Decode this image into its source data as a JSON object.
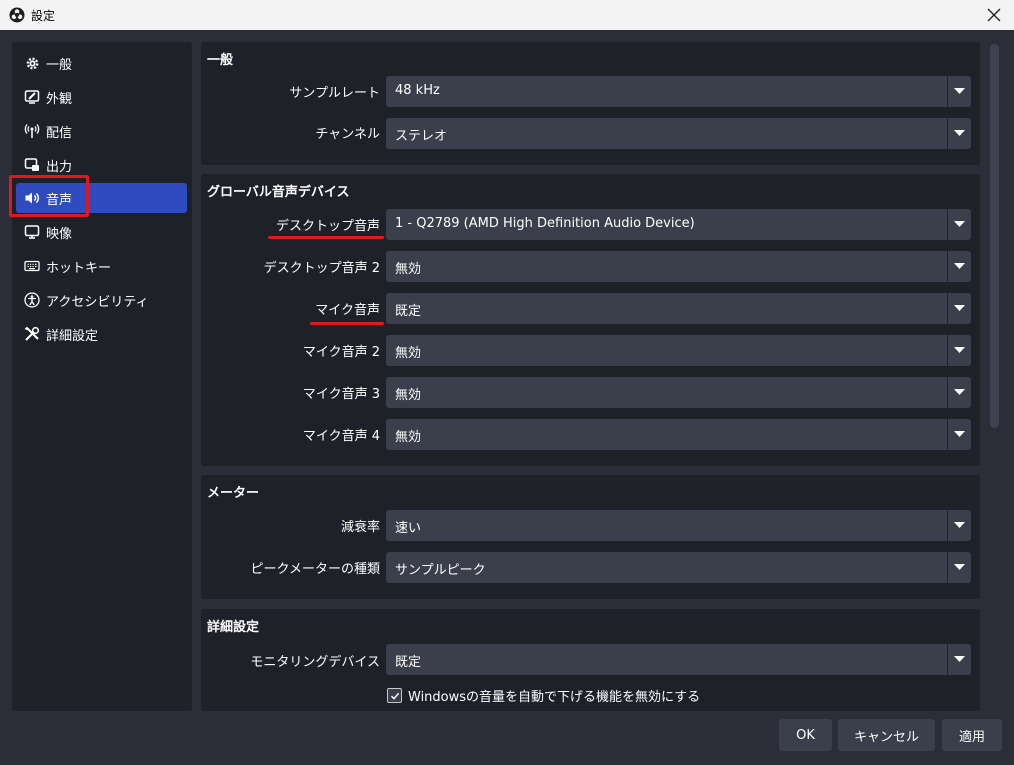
{
  "window": {
    "title": "設定"
  },
  "sidebar": {
    "items": [
      {
        "label": "一般",
        "icon": "gear-icon"
      },
      {
        "label": "外観",
        "icon": "appearance-icon"
      },
      {
        "label": "配信",
        "icon": "broadcast-icon"
      },
      {
        "label": "出力",
        "icon": "output-icon"
      },
      {
        "label": "音声",
        "icon": "speaker-icon",
        "active": true
      },
      {
        "label": "映像",
        "icon": "monitor-icon"
      },
      {
        "label": "ホットキー",
        "icon": "keyboard-icon"
      },
      {
        "label": "アクセシビリティ",
        "icon": "accessibility-icon"
      },
      {
        "label": "詳細設定",
        "icon": "tools-icon"
      }
    ]
  },
  "sections": {
    "general": {
      "title": "一般",
      "sample_rate": {
        "label": "サンプルレート",
        "value": "48 kHz"
      },
      "channels": {
        "label": "チャンネル",
        "value": "ステレオ"
      }
    },
    "global_devices": {
      "title": "グローバル音声デバイス",
      "rows": [
        {
          "label": "デスクトップ音声",
          "value": "1 - Q2789 (AMD High Definition Audio Device)"
        },
        {
          "label": "デスクトップ音声 2",
          "value": "無効"
        },
        {
          "label": "マイク音声",
          "value": "既定"
        },
        {
          "label": "マイク音声 2",
          "value": "無効"
        },
        {
          "label": "マイク音声 3",
          "value": "無効"
        },
        {
          "label": "マイク音声 4",
          "value": "無効"
        }
      ]
    },
    "meters": {
      "title": "メーター",
      "decay": {
        "label": "減衰率",
        "value": "速い"
      },
      "peak_type": {
        "label": "ピークメーターの種類",
        "value": "サンプルピーク"
      }
    },
    "advanced": {
      "title": "詳細設定",
      "monitoring": {
        "label": "モニタリングデバイス",
        "value": "既定"
      },
      "ducking": {
        "label": "Windowsの音量を自動で下げる機能を無効にする",
        "checked": true
      }
    }
  },
  "footer": {
    "ok": "OK",
    "cancel": "キャンセル",
    "apply": "適用"
  },
  "colors": {
    "accent": "#2f4bbf",
    "highlight": "#e0181f",
    "panel": "#1f2129",
    "background": "#2b2e38"
  }
}
